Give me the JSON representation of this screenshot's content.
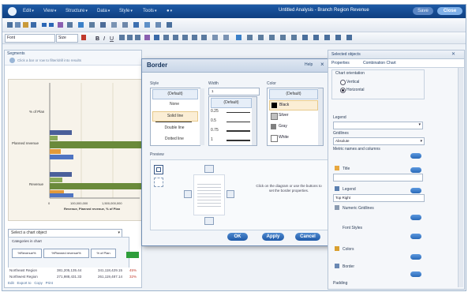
{
  "titlebar": {
    "menus": [
      "Edit",
      "View",
      "Structure",
      "Data",
      "Style",
      "Tools"
    ],
    "document_title": "Untitled Analysis - Branch Region Revenue",
    "save_label": "Save",
    "close_label": "Close"
  },
  "format_toolbar": {
    "font": "Font",
    "size": "Size"
  },
  "left_pane": {
    "header": "Segments",
    "filter_placeholder": "Click a bar or row to filter/drill into results",
    "chart": {
      "category_labels": [
        "% of Plan",
        "Planned revenue",
        "Revenue"
      ],
      "axis_ticks": [
        "0",
        "100,000,000",
        "1,500,000,000"
      ],
      "x_axis_label": "Revenue, Planned revenue, % of Plan"
    },
    "select_object_placeholder": "Select a chart object",
    "categories_label": "Categories in chart",
    "category_chips": [
      "%Revenue%",
      "%Planned revenue%",
      "% of Plan"
    ],
    "table_rows": [
      {
        "name": "Northeast Region",
        "v1": "381,205,135.44",
        "v2": "341,118,429.15",
        "pct": "45%"
      },
      {
        "name": "Northwest Region",
        "v1": "271,988,431.33",
        "v2": "261,119,487.14",
        "pct": "32%"
      }
    ],
    "footer_links": [
      "Edit",
      "Export to",
      "Copy",
      "Print"
    ]
  },
  "dialog": {
    "title": "Border",
    "help": "Help",
    "style_label": "Style",
    "style_items": [
      "(Default)",
      "None",
      "Solid line",
      "Double line",
      "Dotted line"
    ],
    "width_label": "Width",
    "width_items": [
      "(Default)",
      "0.25",
      "0.5",
      "0.75",
      "1"
    ],
    "width_value": "1",
    "color_label": "Color",
    "color_items": [
      "(Default)",
      "Black",
      "Silver",
      "Gray",
      "White"
    ],
    "preview_label": "Preview",
    "hint": "Click on the diagram or use the buttons to set the border properties.",
    "ok": "OK",
    "apply": "Apply",
    "cancel": "Cancel"
  },
  "right_pane": {
    "header": "Selected objects",
    "tab_properties": "Properties",
    "tab_combination": "Combination Chart",
    "chart_orientation_label": "Chart orientation",
    "radio_vertical": "Vertical",
    "radio_horizontal": "Horizontal",
    "orientation_selected": "Horizontal",
    "legend_label": "Legend",
    "legend_value": "",
    "gridlines_label": "Gridlines",
    "gridlines_value": "Absolute",
    "names_label": "Metric names and columns",
    "title_label": "Title",
    "legend2_label": "Legend",
    "legend2_value": "Top Right",
    "numeric_label": "Numeric Gridlines",
    "fonts_label": "Font Styles",
    "colors_label": "Colors",
    "border_label": "Border",
    "footer_label": "Padding"
  }
}
